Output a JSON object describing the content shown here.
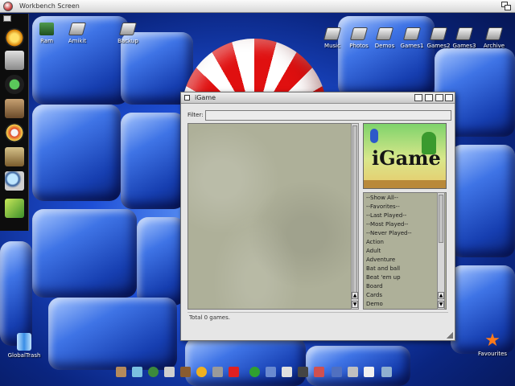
{
  "screen": {
    "title": "Workbench Screen"
  },
  "desktop_icons_left": [
    {
      "label": "Ram",
      "icon": "ram-disk-icon"
    },
    {
      "label": "Amikit",
      "icon": "amikit-drive-icon"
    },
    {
      "label": "Backup",
      "icon": "backup-drive-icon"
    }
  ],
  "desktop_icons_right": [
    {
      "label": "Music",
      "icon": "drive-icon"
    },
    {
      "label": "Photos",
      "icon": "drive-icon"
    },
    {
      "label": "Demos",
      "icon": "drive-icon"
    },
    {
      "label": "Games1",
      "icon": "drive-icon"
    },
    {
      "label": "Games2",
      "icon": "drive-icon"
    },
    {
      "label": "Games3",
      "icon": "drive-icon"
    },
    {
      "label": "Archive",
      "icon": "drive-icon"
    }
  ],
  "dock_icons": [
    "igame-dock-icon",
    "prefs-dock-icon",
    "clock-dock-icon",
    "character-dock-icon",
    "gear-dock-icon",
    "face-dock-icon",
    "magnifier-dock-icon",
    "power-dock-icon"
  ],
  "igame": {
    "title": "iGame",
    "filter_label": "Filter:",
    "filter_value": "",
    "logo_text": "iGame",
    "genres": [
      "--Show All--",
      "--Favorites--",
      "--Last Played--",
      "--Most Played--",
      "--Never Played--",
      "Action",
      "Adult",
      "Adventure",
      "Bat and ball",
      "Beat 'em up",
      "Board",
      "Cards",
      "Demo"
    ],
    "status": "Total 0 games."
  },
  "bottom_icons": {
    "left_label": "GlobalTrash",
    "right_label": "Favourites"
  },
  "colors": {
    "window_bg": "#e6e6e6",
    "list_bg": "#aeb099",
    "desktop_blue": "#1e4fd6"
  }
}
